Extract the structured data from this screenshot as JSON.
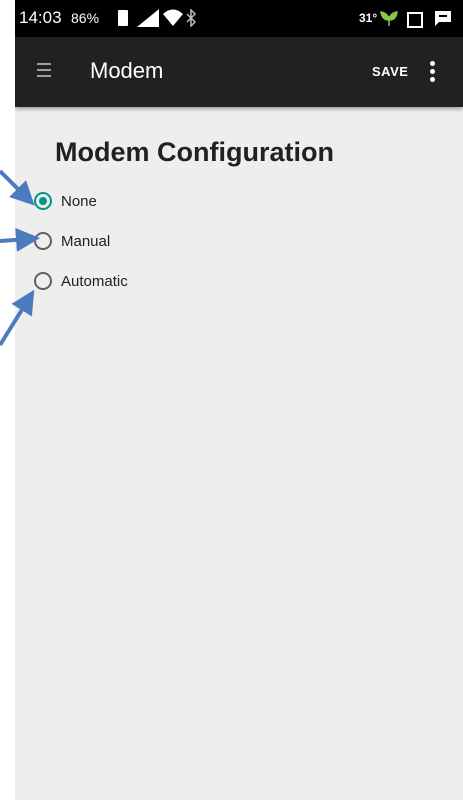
{
  "status_bar": {
    "time": "14:03",
    "battery_percent": "86%",
    "temperature": "31°",
    "icons": [
      "battery-icon",
      "signal-icon",
      "wifi-icon",
      "bluetooth-icon",
      "leaf-icon",
      "square-icon",
      "chat-icon"
    ]
  },
  "app_bar": {
    "title": "Modem",
    "save_label": "SAVE",
    "menu_icon": "hamburger-menu-icon",
    "overflow_icon": "more-vert-icon"
  },
  "main": {
    "section_title": "Modem Configuration",
    "radio_options": [
      {
        "label": "None",
        "checked": true
      },
      {
        "label": "Manual",
        "checked": false
      },
      {
        "label": "Automatic",
        "checked": false
      }
    ]
  },
  "colors": {
    "status_bar": "#000000",
    "app_bar": "#212121",
    "background": "#eeeeee",
    "accent": "#009688",
    "annotation_arrow": "#4a7bbf"
  }
}
